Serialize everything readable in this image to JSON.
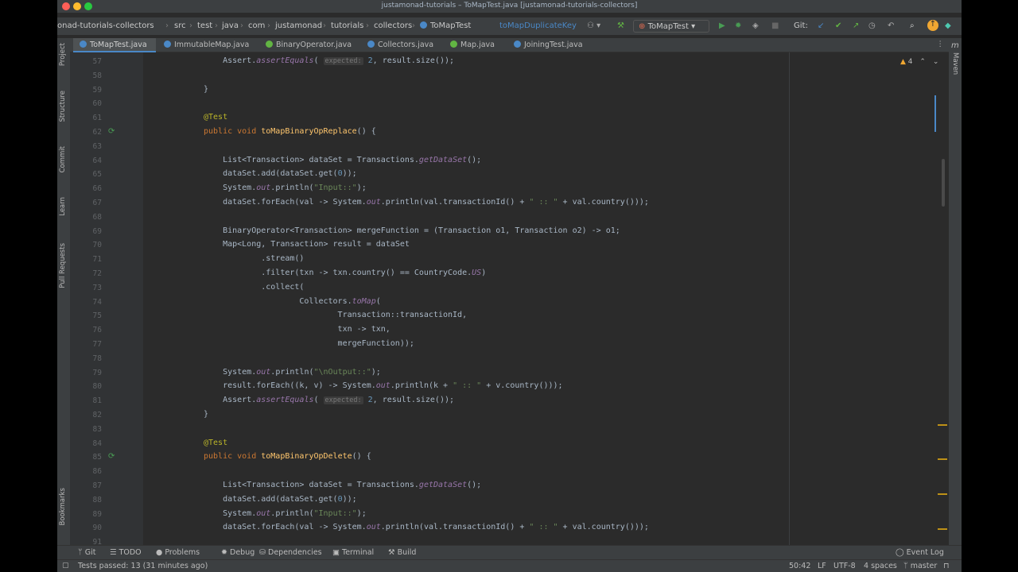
{
  "window": {
    "title": "justamonad-tutorials – ToMapTest.java [justamonad-tutorials-collectors]"
  },
  "breadcrumbs": [
    "onad-tutorials-collectors",
    "src",
    "test",
    "java",
    "com",
    "justamonad",
    "tutorials",
    "collectors",
    "ToMapTest"
  ],
  "navbar": {
    "method_crumb": "toMapDuplicateKey",
    "run_config": "ToMapTest",
    "git_label": "Git:"
  },
  "tabs": [
    {
      "label": "ToMapTest.java",
      "active": true,
      "color": "#4a88c7"
    },
    {
      "label": "ImmutableMap.java",
      "active": false,
      "color": "#4a88c7"
    },
    {
      "label": "BinaryOperator.java",
      "active": false,
      "color": "#62b543"
    },
    {
      "label": "Collectors.java",
      "active": false,
      "color": "#4a88c7"
    },
    {
      "label": "Map.java",
      "active": false,
      "color": "#62b543"
    },
    {
      "label": "JoiningTest.java",
      "active": false,
      "color": "#4a88c7"
    }
  ],
  "left_tools": [
    "Project",
    "Structure",
    "Commit",
    "Learn",
    "Pull Requests",
    "Bookmarks"
  ],
  "right_tools": [
    "Maven"
  ],
  "inspection": {
    "warnings": "4"
  },
  "editor": {
    "lines": [
      {
        "n": "57",
        "indent": 1,
        "segs": [
          [
            "",
            "Assert."
          ],
          [
            "it",
            "assertEquals"
          ],
          [
            "",
            "( "
          ],
          [
            "hint",
            "expected:"
          ],
          [
            "",
            " "
          ],
          [
            "num",
            "2"
          ],
          [
            "",
            ", result.size());"
          ]
        ]
      },
      {
        "n": "58",
        "indent": 0,
        "segs": []
      },
      {
        "n": "59",
        "indent": 0,
        "segs": [
          [
            "",
            "}"
          ]
        ]
      },
      {
        "n": "60",
        "indent": 0,
        "segs": []
      },
      {
        "n": "61",
        "indent": 0,
        "segs": [
          [
            "an",
            "@Test"
          ]
        ]
      },
      {
        "n": "62",
        "indent": 0,
        "segs": [
          [
            "kw",
            "public void "
          ],
          [
            "fn",
            "toMapBinaryOpReplace"
          ],
          [
            "",
            "() {"
          ]
        ]
      },
      {
        "n": "63",
        "indent": 0,
        "segs": []
      },
      {
        "n": "64",
        "indent": 1,
        "segs": [
          [
            "",
            "List<Transaction> dataSet = Transactions."
          ],
          [
            "it",
            "getDataSet"
          ],
          [
            "",
            "();"
          ]
        ]
      },
      {
        "n": "65",
        "indent": 1,
        "segs": [
          [
            "",
            "dataSet.add(dataSet.get("
          ],
          [
            "num",
            "0"
          ],
          [
            "",
            "));"
          ]
        ]
      },
      {
        "n": "66",
        "indent": 1,
        "segs": [
          [
            "",
            "System."
          ],
          [
            "it",
            "out"
          ],
          [
            "",
            ".println("
          ],
          [
            "st",
            "\"Input::\""
          ],
          [
            "",
            ");"
          ]
        ]
      },
      {
        "n": "67",
        "indent": 1,
        "segs": [
          [
            "",
            "dataSet.forEach(val -> System."
          ],
          [
            "it",
            "out"
          ],
          [
            "",
            ".println(val.transactionId() + "
          ],
          [
            "st",
            "\" :: \""
          ],
          [
            "",
            " + val.country()));"
          ]
        ]
      },
      {
        "n": "68",
        "indent": 0,
        "segs": []
      },
      {
        "n": "69",
        "indent": 1,
        "segs": [
          [
            "",
            "BinaryOperator<Transaction> mergeFunction = (Transaction o1, Transaction o2) -> o1;"
          ]
        ]
      },
      {
        "n": "70",
        "indent": 1,
        "segs": [
          [
            "",
            "Map<Long, Transaction> result = dataSet"
          ]
        ]
      },
      {
        "n": "71",
        "indent": 3,
        "segs": [
          [
            "",
            ".stream()"
          ]
        ]
      },
      {
        "n": "72",
        "indent": 3,
        "segs": [
          [
            "",
            ".filter(txn -> txn.country() == CountryCode."
          ],
          [
            "it",
            "US"
          ],
          [
            "",
            ")"
          ]
        ]
      },
      {
        "n": "73",
        "indent": 3,
        "segs": [
          [
            "",
            ".collect("
          ]
        ]
      },
      {
        "n": "74",
        "indent": 5,
        "segs": [
          [
            "",
            "Collectors."
          ],
          [
            "it",
            "toMap"
          ],
          [
            "",
            "("
          ]
        ]
      },
      {
        "n": "75",
        "indent": 7,
        "segs": [
          [
            "",
            "Transaction::transactionId,"
          ]
        ]
      },
      {
        "n": "76",
        "indent": 7,
        "segs": [
          [
            "",
            "txn -> txn,"
          ]
        ]
      },
      {
        "n": "77",
        "indent": 7,
        "segs": [
          [
            "",
            "mergeFunction));"
          ]
        ]
      },
      {
        "n": "78",
        "indent": 0,
        "segs": []
      },
      {
        "n": "79",
        "indent": 1,
        "segs": [
          [
            "",
            "System."
          ],
          [
            "it",
            "out"
          ],
          [
            "",
            ".println("
          ],
          [
            "st",
            "\"\\nOutput::\""
          ],
          [
            "",
            ");"
          ]
        ]
      },
      {
        "n": "80",
        "indent": 1,
        "segs": [
          [
            "",
            "result.forEach((k, v) -> System."
          ],
          [
            "it",
            "out"
          ],
          [
            "",
            ".println(k + "
          ],
          [
            "st",
            "\" :: \""
          ],
          [
            "",
            " + v.country()));"
          ]
        ]
      },
      {
        "n": "81",
        "indent": 1,
        "segs": [
          [
            "",
            "Assert."
          ],
          [
            "it",
            "assertEquals"
          ],
          [
            "",
            "( "
          ],
          [
            "hint",
            "expected:"
          ],
          [
            "",
            " "
          ],
          [
            "num",
            "2"
          ],
          [
            "",
            ", result.size());"
          ]
        ]
      },
      {
        "n": "82",
        "indent": 0,
        "segs": [
          [
            "",
            "}"
          ]
        ]
      },
      {
        "n": "83",
        "indent": 0,
        "segs": []
      },
      {
        "n": "84",
        "indent": 0,
        "segs": [
          [
            "an",
            "@Test"
          ]
        ]
      },
      {
        "n": "85",
        "indent": 0,
        "segs": [
          [
            "kw",
            "public void "
          ],
          [
            "fn",
            "toMapBinaryOpDelete"
          ],
          [
            "",
            "() {"
          ]
        ]
      },
      {
        "n": "86",
        "indent": 0,
        "segs": []
      },
      {
        "n": "87",
        "indent": 1,
        "segs": [
          [
            "",
            "List<Transaction> dataSet = Transactions."
          ],
          [
            "it",
            "getDataSet"
          ],
          [
            "",
            "();"
          ]
        ]
      },
      {
        "n": "88",
        "indent": 1,
        "segs": [
          [
            "",
            "dataSet.add(dataSet.get("
          ],
          [
            "num",
            "0"
          ],
          [
            "",
            "));"
          ]
        ]
      },
      {
        "n": "89",
        "indent": 1,
        "segs": [
          [
            "",
            "System."
          ],
          [
            "it",
            "out"
          ],
          [
            "",
            ".println("
          ],
          [
            "st",
            "\"Input::\""
          ],
          [
            "",
            ");"
          ]
        ]
      },
      {
        "n": "90",
        "indent": 1,
        "segs": [
          [
            "",
            "dataSet.forEach(val -> System."
          ],
          [
            "it",
            "out"
          ],
          [
            "",
            ".println(val.transactionId() + "
          ],
          [
            "st",
            "\" :: \""
          ],
          [
            "",
            " + val.country()));"
          ]
        ]
      },
      {
        "n": "91",
        "indent": 0,
        "segs": []
      }
    ]
  },
  "bottom_tools": [
    {
      "label": "Git",
      "icon": "git-icon"
    },
    {
      "label": "TODO",
      "icon": "todo-icon"
    },
    {
      "label": "Problems",
      "icon": "problems-icon"
    },
    {
      "label": "Debug",
      "icon": "debug-icon"
    },
    {
      "label": "Dependencies",
      "icon": "dependencies-icon"
    },
    {
      "label": "Terminal",
      "icon": "terminal-icon"
    },
    {
      "label": "Build",
      "icon": "build-icon"
    }
  ],
  "event_log": "Event Log",
  "status": {
    "message": "Tests passed: 13 (31 minutes ago)",
    "position": "50:42",
    "line_sep": "LF",
    "encoding": "UTF-8",
    "indent": "4 spaces",
    "branch": "master"
  },
  "colors": {
    "accent": "#4a88c7",
    "run_green": "#499c54",
    "warn": "#f0a732"
  }
}
